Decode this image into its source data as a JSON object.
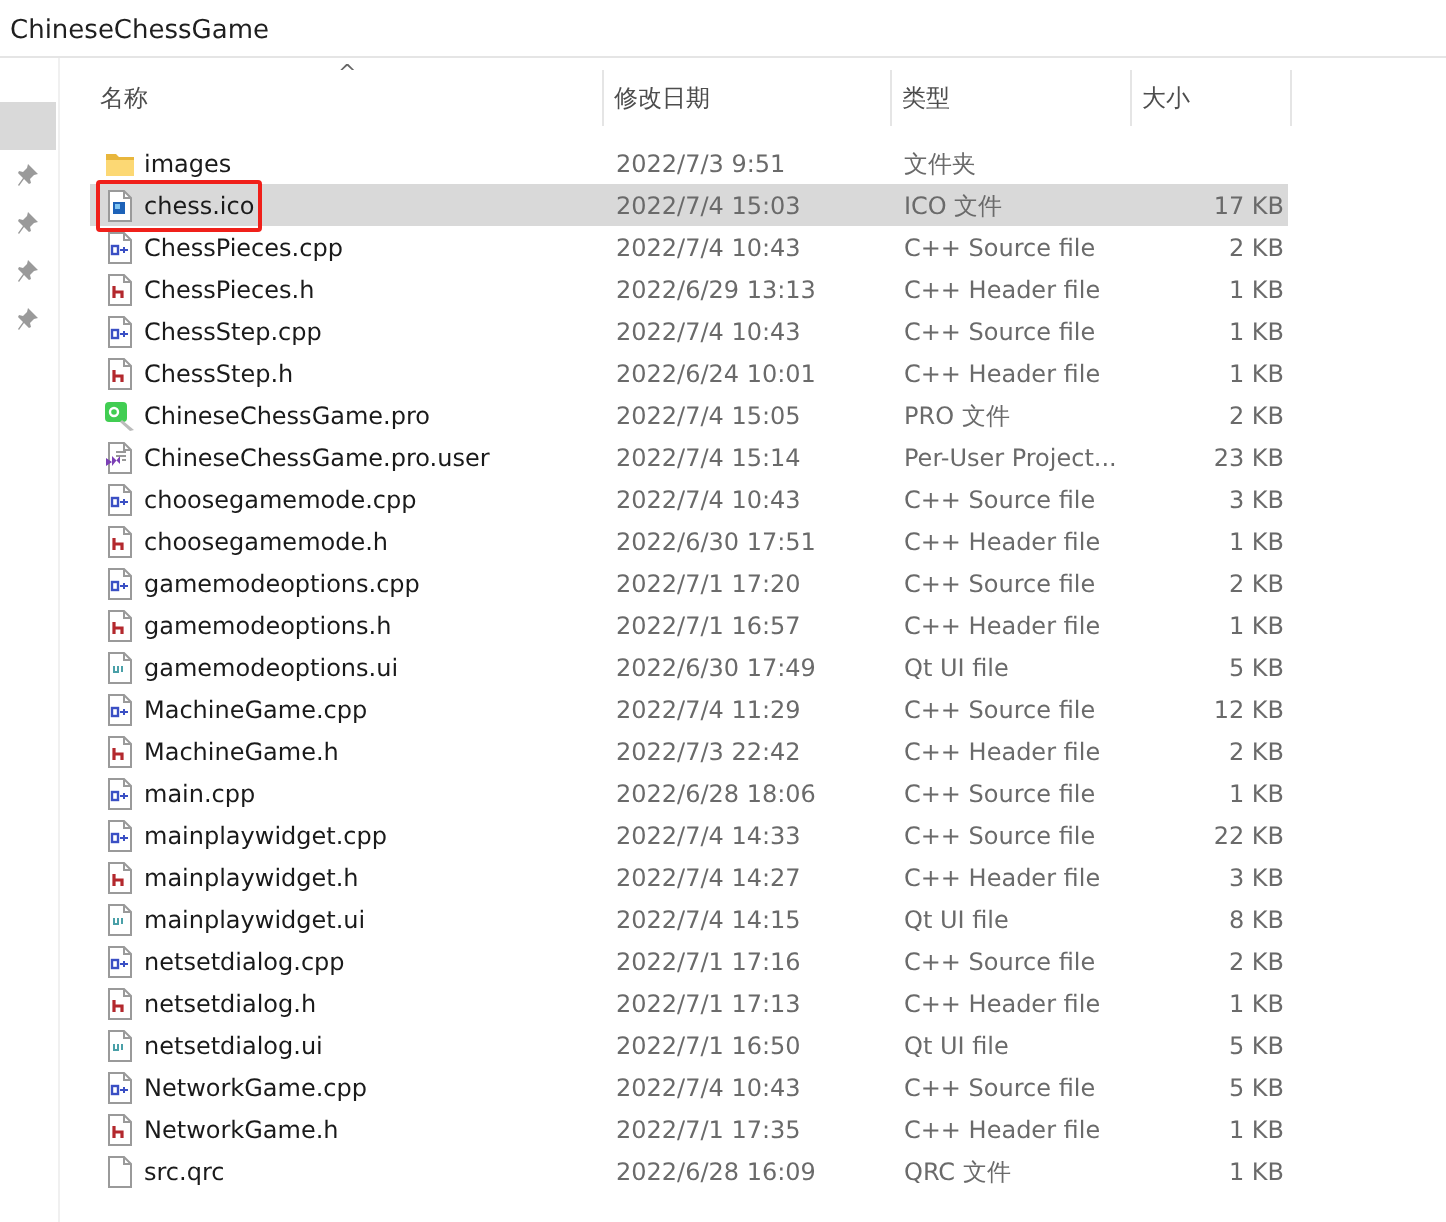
{
  "window": {
    "title": "ChineseChessGame"
  },
  "nav_pane": {
    "items": [
      {
        "selected": true,
        "pinned": false
      },
      {
        "selected": false,
        "pinned": true
      },
      {
        "selected": false,
        "pinned": true
      },
      {
        "selected": false,
        "pinned": true
      },
      {
        "selected": false,
        "pinned": true
      }
    ]
  },
  "table": {
    "sort_indicator": "^",
    "columns": [
      "名称",
      "修改日期",
      "类型",
      "大小"
    ],
    "rows": [
      {
        "kind": "folder",
        "name": "images",
        "modified": "2022/7/3 9:51",
        "type": "文件夹",
        "size": "",
        "selected": false,
        "outlined": false
      },
      {
        "kind": "ico",
        "name": "chess.ico",
        "modified": "2022/7/4 15:03",
        "type": "ICO 文件",
        "size": "17 KB",
        "selected": true,
        "outlined": true
      },
      {
        "kind": "cpp",
        "name": "ChessPieces.cpp",
        "modified": "2022/7/4 10:43",
        "type": "C++ Source file",
        "size": "2 KB",
        "selected": false,
        "outlined": false
      },
      {
        "kind": "h",
        "name": "ChessPieces.h",
        "modified": "2022/6/29 13:13",
        "type": "C++ Header file",
        "size": "1 KB",
        "selected": false,
        "outlined": false
      },
      {
        "kind": "cpp",
        "name": "ChessStep.cpp",
        "modified": "2022/7/4 10:43",
        "type": "C++ Source file",
        "size": "1 KB",
        "selected": false,
        "outlined": false
      },
      {
        "kind": "h",
        "name": "ChessStep.h",
        "modified": "2022/6/24 10:01",
        "type": "C++ Header file",
        "size": "1 KB",
        "selected": false,
        "outlined": false
      },
      {
        "kind": "pro",
        "name": "ChineseChessGame.pro",
        "modified": "2022/7/4 15:05",
        "type": "PRO 文件",
        "size": "2 KB",
        "selected": false,
        "outlined": false
      },
      {
        "kind": "user",
        "name": "ChineseChessGame.pro.user",
        "modified": "2022/7/4 15:14",
        "type": "Per-User Project...",
        "size": "23 KB",
        "selected": false,
        "outlined": false
      },
      {
        "kind": "cpp",
        "name": "choosegamemode.cpp",
        "modified": "2022/7/4 10:43",
        "type": "C++ Source file",
        "size": "3 KB",
        "selected": false,
        "outlined": false
      },
      {
        "kind": "h",
        "name": "choosegamemode.h",
        "modified": "2022/6/30 17:51",
        "type": "C++ Header file",
        "size": "1 KB",
        "selected": false,
        "outlined": false
      },
      {
        "kind": "cpp",
        "name": "gamemodeoptions.cpp",
        "modified": "2022/7/1 17:20",
        "type": "C++ Source file",
        "size": "2 KB",
        "selected": false,
        "outlined": false
      },
      {
        "kind": "h",
        "name": "gamemodeoptions.h",
        "modified": "2022/7/1 16:57",
        "type": "C++ Header file",
        "size": "1 KB",
        "selected": false,
        "outlined": false
      },
      {
        "kind": "ui",
        "name": "gamemodeoptions.ui",
        "modified": "2022/6/30 17:49",
        "type": "Qt UI file",
        "size": "5 KB",
        "selected": false,
        "outlined": false
      },
      {
        "kind": "cpp",
        "name": "MachineGame.cpp",
        "modified": "2022/7/4 11:29",
        "type": "C++ Source file",
        "size": "12 KB",
        "selected": false,
        "outlined": false
      },
      {
        "kind": "h",
        "name": "MachineGame.h",
        "modified": "2022/7/3 22:42",
        "type": "C++ Header file",
        "size": "2 KB",
        "selected": false,
        "outlined": false
      },
      {
        "kind": "cpp",
        "name": "main.cpp",
        "modified": "2022/6/28 18:06",
        "type": "C++ Source file",
        "size": "1 KB",
        "selected": false,
        "outlined": false
      },
      {
        "kind": "cpp",
        "name": "mainplaywidget.cpp",
        "modified": "2022/7/4 14:33",
        "type": "C++ Source file",
        "size": "22 KB",
        "selected": false,
        "outlined": false
      },
      {
        "kind": "h",
        "name": "mainplaywidget.h",
        "modified": "2022/7/4 14:27",
        "type": "C++ Header file",
        "size": "3 KB",
        "selected": false,
        "outlined": false
      },
      {
        "kind": "ui",
        "name": "mainplaywidget.ui",
        "modified": "2022/7/4 14:15",
        "type": "Qt UI file",
        "size": "8 KB",
        "selected": false,
        "outlined": false
      },
      {
        "kind": "cpp",
        "name": "netsetdialog.cpp",
        "modified": "2022/7/1 17:16",
        "type": "C++ Source file",
        "size": "2 KB",
        "selected": false,
        "outlined": false
      },
      {
        "kind": "h",
        "name": "netsetdialog.h",
        "modified": "2022/7/1 17:13",
        "type": "C++ Header file",
        "size": "1 KB",
        "selected": false,
        "outlined": false
      },
      {
        "kind": "ui",
        "name": "netsetdialog.ui",
        "modified": "2022/7/1 16:50",
        "type": "Qt UI file",
        "size": "5 KB",
        "selected": false,
        "outlined": false
      },
      {
        "kind": "cpp",
        "name": "NetworkGame.cpp",
        "modified": "2022/7/4 10:43",
        "type": "C++ Source file",
        "size": "5 KB",
        "selected": false,
        "outlined": false
      },
      {
        "kind": "h",
        "name": "NetworkGame.h",
        "modified": "2022/7/1 17:35",
        "type": "C++ Header file",
        "size": "1 KB",
        "selected": false,
        "outlined": false
      },
      {
        "kind": "qrc",
        "name": "src.qrc",
        "modified": "2022/6/28 16:09",
        "type": "QRC 文件",
        "size": "1 KB",
        "selected": false,
        "outlined": false
      }
    ]
  }
}
